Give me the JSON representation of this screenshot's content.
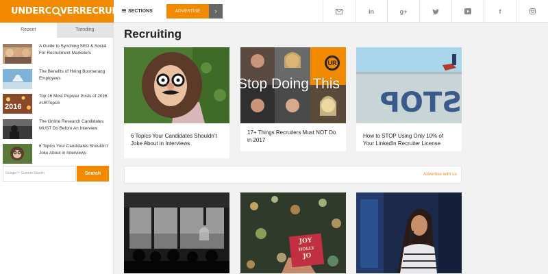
{
  "brand": {
    "logo_part1": "UNDERC",
    "logo_part2": "VERRECRUITER"
  },
  "header": {
    "sections_label": "SECTIONS",
    "advertise_label": "ADVERTISE",
    "advertise_arrow": "›",
    "social": [
      {
        "icon": "email-icon",
        "glyph": "✉"
      },
      {
        "icon": "linkedin-icon",
        "glyph": "in"
      },
      {
        "icon": "google-plus-icon",
        "glyph": "g+"
      },
      {
        "icon": "twitter-icon",
        "glyph": "🐦"
      },
      {
        "icon": "youtube-icon",
        "glyph": "▶"
      },
      {
        "icon": "facebook-icon",
        "glyph": "f"
      },
      {
        "icon": "instagram-icon",
        "glyph": "◘"
      }
    ]
  },
  "sidebar": {
    "tabs": [
      "Recent",
      "Trending"
    ],
    "items": [
      {
        "title": "A Guide to Synching SEO & Social For Recruitment Marketers"
      },
      {
        "title": "The Benefits of Hiring Boomerang Employees"
      },
      {
        "title": "Top 16 Most Popular Posts of 2016 #URTop16"
      },
      {
        "title": "The Online Research Candidates MUST Do Before An Interview"
      },
      {
        "title": "6 Topics Your Candidates Shouldn’t Joke About in Interviews"
      }
    ],
    "search_placeholder": "Google™ Custom Search",
    "search_button": "Search"
  },
  "main": {
    "title": "Recruiting",
    "cards": [
      {
        "title": "6 Topics Your Candidates Shouldn’t Joke About in Interviews"
      },
      {
        "title": "17+ Things Recruiters Must NOT Do in 2017",
        "image_text": "Stop Doing This",
        "badge": "UR"
      },
      {
        "title": "How to STOP Using Only 10% of Your LinkedIn Recruiter License"
      }
    ],
    "ad_label": "Advertise with us",
    "joy_card_text": [
      "JOY",
      "HOLLY",
      "JO"
    ]
  },
  "colors": {
    "accent": "#f28a00",
    "link_orange": "#e98a1a"
  }
}
